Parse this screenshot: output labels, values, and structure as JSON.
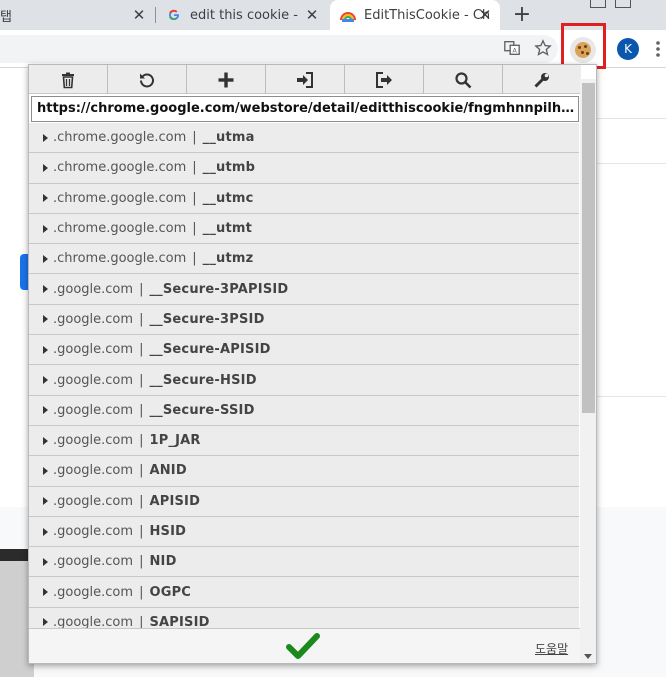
{
  "browser": {
    "tabs": [
      {
        "title": "탭"
      },
      {
        "title": "edit this cookie - G"
      },
      {
        "title": "EditThisCookie - Ch"
      }
    ],
    "tab_close": "✕",
    "new_tab": "+",
    "profile_initial": "K"
  },
  "popup": {
    "toolbar": [
      {
        "icon": "trash-icon"
      },
      {
        "icon": "undo-icon"
      },
      {
        "icon": "add-icon"
      },
      {
        "icon": "import-icon"
      },
      {
        "icon": "export-icon"
      },
      {
        "icon": "search-icon"
      },
      {
        "icon": "wrench-icon"
      }
    ],
    "url": "https://chrome.google.com/webstore/detail/editthiscookie/fngmhnnpilhplaeedifhc…",
    "cookies": [
      {
        "domain": ".chrome.google.com",
        "name": "__utma"
      },
      {
        "domain": ".chrome.google.com",
        "name": "__utmb"
      },
      {
        "domain": ".chrome.google.com",
        "name": "__utmc"
      },
      {
        "domain": ".chrome.google.com",
        "name": "__utmt"
      },
      {
        "domain": ".chrome.google.com",
        "name": "__utmz"
      },
      {
        "domain": ".google.com",
        "name": "__Secure-3PAPISID"
      },
      {
        "domain": ".google.com",
        "name": "__Secure-3PSID"
      },
      {
        "domain": ".google.com",
        "name": "__Secure-APISID"
      },
      {
        "domain": ".google.com",
        "name": "__Secure-HSID"
      },
      {
        "domain": ".google.com",
        "name": "__Secure-SSID"
      },
      {
        "domain": ".google.com",
        "name": "1P_JAR"
      },
      {
        "domain": ".google.com",
        "name": "ANID"
      },
      {
        "domain": ".google.com",
        "name": "APISID"
      },
      {
        "domain": ".google.com",
        "name": "HSID"
      },
      {
        "domain": ".google.com",
        "name": "NID"
      },
      {
        "domain": ".google.com",
        "name": "OGPC"
      },
      {
        "domain": ".google.com",
        "name": "SAPISID"
      }
    ],
    "separator": "|",
    "help_label": "도움말",
    "colors": {
      "check": "#1a8a1a",
      "highlight": "#e02020"
    }
  }
}
